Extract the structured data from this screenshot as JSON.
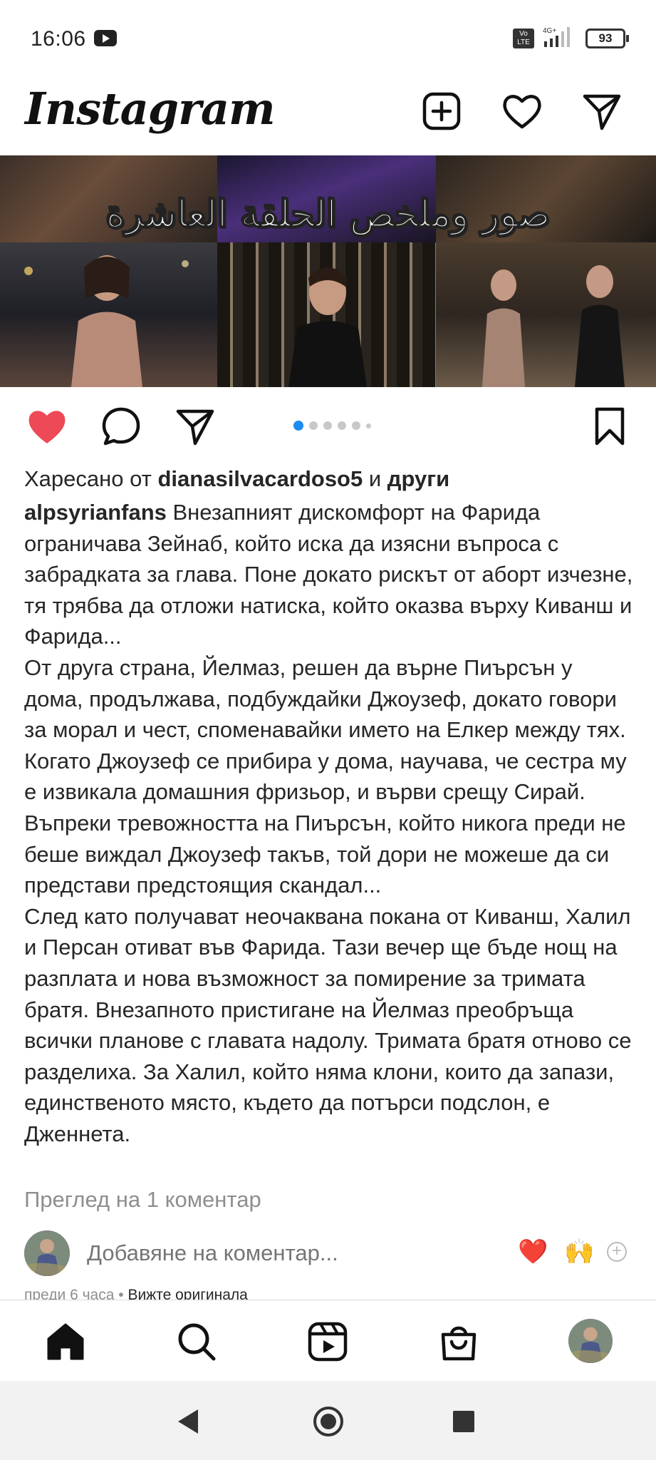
{
  "status_bar": {
    "time": "16:06",
    "network": "4G+",
    "volte": "Vo LTE",
    "battery": "93"
  },
  "header": {
    "logo": "Instagram",
    "icons": [
      "add-post-icon",
      "heart-icon",
      "direct-message-icon"
    ]
  },
  "post": {
    "image_overlay_text": "صور وملخص الحلقة العاشرة",
    "carousel_total": 6,
    "carousel_active": 1,
    "liked": true,
    "colors": {
      "like": "#ed4956",
      "active_dot": "#1d8bf0",
      "muted_text": "#8e8e8e"
    },
    "likes": {
      "prefix": "Харесано от ",
      "user": "dianasilvacardoso5",
      "joiner": " и ",
      "others": "други"
    },
    "caption": {
      "username": "alpsyrianfans",
      "paragraphs": [
        " Внезапният дискомфорт на Фарида ограничава Зейнаб, който иска да изясни въпроса с забрадката за глава. Поне докато рискът от аборт изчезне, тя трябва да отложи натиска, който оказва върху Киванш и Фарида...",
        "От друга страна, Йелмаз, решен да върне Пиърсън у дома, продължава, подбуждайки Джоузеф, докато говори за морал и чест, споменавайки името на Елкер между тях. Когато Джоузеф се прибира у дома, научава, че сестра му е извикала домашния фризьор, и върви срещу Сирай. Въпреки тревожността на Пиърсън, който никога преди не беше виждал Джоузеф такъв, той дори не можеше да си представи предстоящия скандал...",
        "След като получават неочаквана покана от Киванш, Халил и Персан отиват във Фарида. Тази вечер ще бъде нощ на разплата и нова възможност за помирение за тримата братя. Внезапното пристигане на Йелмаз преобръща всички планове с главата надолу. Тримата братя отново се разделиха. За Халил, който няма клони, които да запази, единственото място, където да потърси подслон, е Дженнета."
      ]
    },
    "view_comments": "Преглед на 1 коментар",
    "comment_placeholder": "Добавяне на коментар...",
    "quick_reactions": [
      "❤️",
      "🙌"
    ],
    "timestamp": "преди 6 часа",
    "timestamp_sep": " • ",
    "see_original": "Вижте оригинала"
  },
  "bottom_nav": {
    "items": [
      "home-icon",
      "search-icon",
      "reels-icon",
      "shop-icon",
      "profile-avatar"
    ]
  }
}
